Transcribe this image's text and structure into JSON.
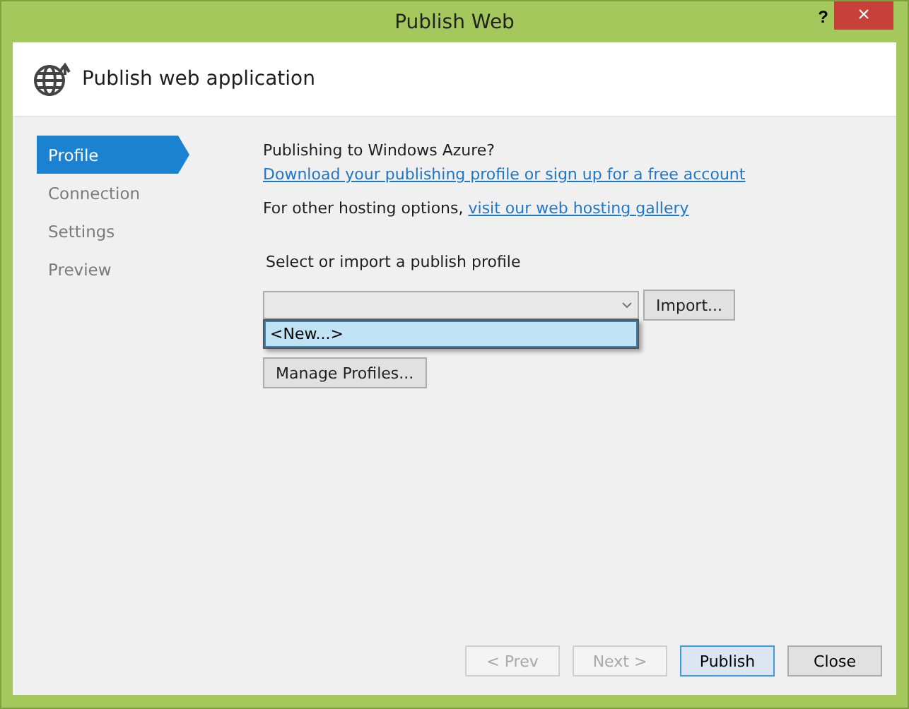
{
  "window": {
    "title": "Publish Web",
    "help": "?",
    "close": "×"
  },
  "header": {
    "title": "Publish web application"
  },
  "nav": [
    {
      "label": "Profile",
      "selected": true
    },
    {
      "label": "Connection",
      "selected": false
    },
    {
      "label": "Settings",
      "selected": false
    },
    {
      "label": "Preview",
      "selected": false
    }
  ],
  "azure": {
    "heading": "Publishing to Windows Azure?",
    "link": "Download your publishing profile or sign up for a free account"
  },
  "hosting": {
    "text": "For other hosting options, ",
    "link": "visit our web hosting gallery"
  },
  "profile": {
    "label": "Select or import a publish profile",
    "expanded": true,
    "options": [
      {
        "label": "<New...>",
        "selected": true
      }
    ],
    "import": "Import...",
    "manage": "Manage Profiles..."
  },
  "buttons": [
    {
      "label": "< Prev",
      "disabled": true,
      "default": false
    },
    {
      "label": "Next >",
      "disabled": true,
      "default": false
    },
    {
      "label": "Publish",
      "disabled": false,
      "default": true
    },
    {
      "label": "Close",
      "disabled": false,
      "default": false
    }
  ]
}
